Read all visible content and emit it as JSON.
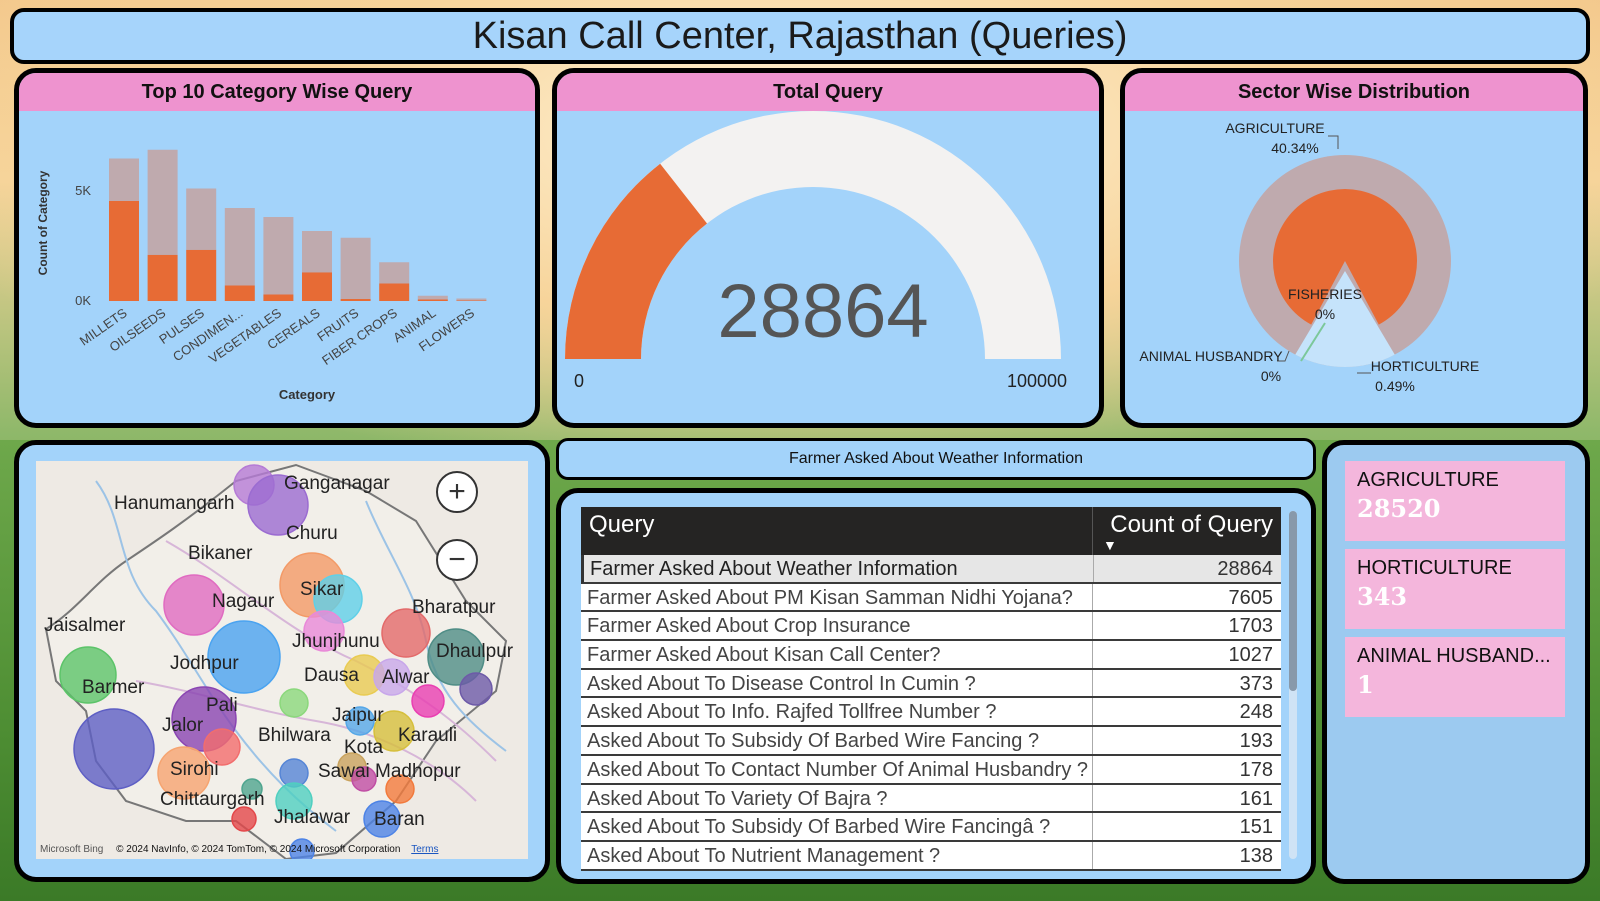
{
  "title": "Kisan Call Center, Rajasthan (Queries)",
  "colors": {
    "accent": "#e76b35",
    "panel": "#a3d3fa",
    "header": "#ee93cf",
    "muted": "#bfaaae"
  },
  "category_card": {
    "title": "Top 10 Category Wise Query",
    "chart_data": {
      "type": "bar",
      "xlabel": "Category",
      "ylabel": "Count of Category",
      "yticks": [
        "5K",
        "0K"
      ],
      "ylim": [
        0,
        6000
      ],
      "categories": [
        "MILLETS",
        "OILSEEDS",
        "PULSES",
        "CONDIMEN...",
        "VEGETABLES",
        "CEREALS",
        "FRUITS",
        "FIBER CROPS",
        "ANIMAL",
        "FLOWERS"
      ],
      "series": [
        {
          "values": [
            4000,
            1850,
            2050,
            620,
            260,
            1150,
            80,
            700,
            60,
            20
          ]
        },
        {
          "values": [
            1700,
            4200,
            2450,
            3100,
            3100,
            1650,
            2450,
            850,
            150,
            80
          ]
        }
      ]
    }
  },
  "total_card": {
    "title": "Total Query",
    "chart_data": {
      "type": "gauge",
      "value": 28864,
      "min": 0,
      "max": 100000
    },
    "value_label": "28864",
    "min_label": "0",
    "max_label": "100000"
  },
  "sector_card": {
    "title": "Sector Wise Distribution",
    "chart_data": {
      "type": "pie",
      "slices": [
        {
          "label": "AGRICULTURE",
          "pct_label": "40.34%",
          "value": 40.34
        },
        {
          "label": "HORTICULTURE",
          "pct_label": "0.49%",
          "value": 0.49
        },
        {
          "label": "FISHERIES",
          "pct_label": "0%",
          "value": 0
        },
        {
          "label": "ANIMAL HUSBANDRY",
          "pct_label": "0%",
          "value": 0
        }
      ]
    }
  },
  "map": {
    "labels": [
      "Ganganagar",
      "Hanumangarh",
      "Churu",
      "Bikaner",
      "Sikar",
      "Nagaur",
      "Bharatpur",
      "Jaisalmer",
      "Jhunjhunu",
      "Dhaulpur",
      "Jodhpur",
      "Dausa",
      "Alwar",
      "Barmer",
      "Pali",
      "Jaipur",
      "Jalor",
      "Karauli",
      "Bhilwara",
      "Kota",
      "Sirohi",
      "Sawai Madhopur",
      "Chittaurgarh",
      "Jhalawar",
      "Baran"
    ],
    "zoom_in": "+",
    "zoom_out": "−",
    "credit_brand": "Microsoft Bing",
    "credit": "© 2024 NavInfo, © 2024 TomTom, © 2024 Microsoft Corporation",
    "terms": "Terms"
  },
  "filter_label": "Farmer Asked About Weather Information",
  "table": {
    "col_query": "Query",
    "col_count": "Count of Query",
    "sort_icon": "▼",
    "rows": [
      {
        "query": "Farmer Asked About Weather Information",
        "count": "28864"
      },
      {
        "query": "Farmer Asked About PM Kisan Samman Nidhi Yojana?",
        "count": "7605"
      },
      {
        "query": "Farmer Asked About Crop Insurance",
        "count": "1703"
      },
      {
        "query": "Farmer Asked About Kisan Call Center?",
        "count": "1027"
      },
      {
        "query": "Asked About To Disease Control In Cumin ?",
        "count": "373"
      },
      {
        "query": "Asked About To Info. Rajfed Tollfree Number ?",
        "count": "248"
      },
      {
        "query": "Asked About To Subsidy Of Barbed Wire Fancing ?",
        "count": "193"
      },
      {
        "query": "Asked About To Contact Number Of Animal Husbandry ?",
        "count": "178"
      },
      {
        "query": "Asked About To Variety Of Bajra ?",
        "count": "161"
      },
      {
        "query": "Asked About To Subsidy Of Barbed Wire Fancingâ ?",
        "count": "151"
      },
      {
        "query": "Asked About To Nutrient Management ?",
        "count": "138"
      }
    ]
  },
  "kpis": [
    {
      "label": "AGRICULTURE",
      "value": "28520"
    },
    {
      "label": "HORTICULTURE",
      "value": "343"
    },
    {
      "label": "ANIMAL HUSBAND...",
      "value": "1"
    }
  ]
}
